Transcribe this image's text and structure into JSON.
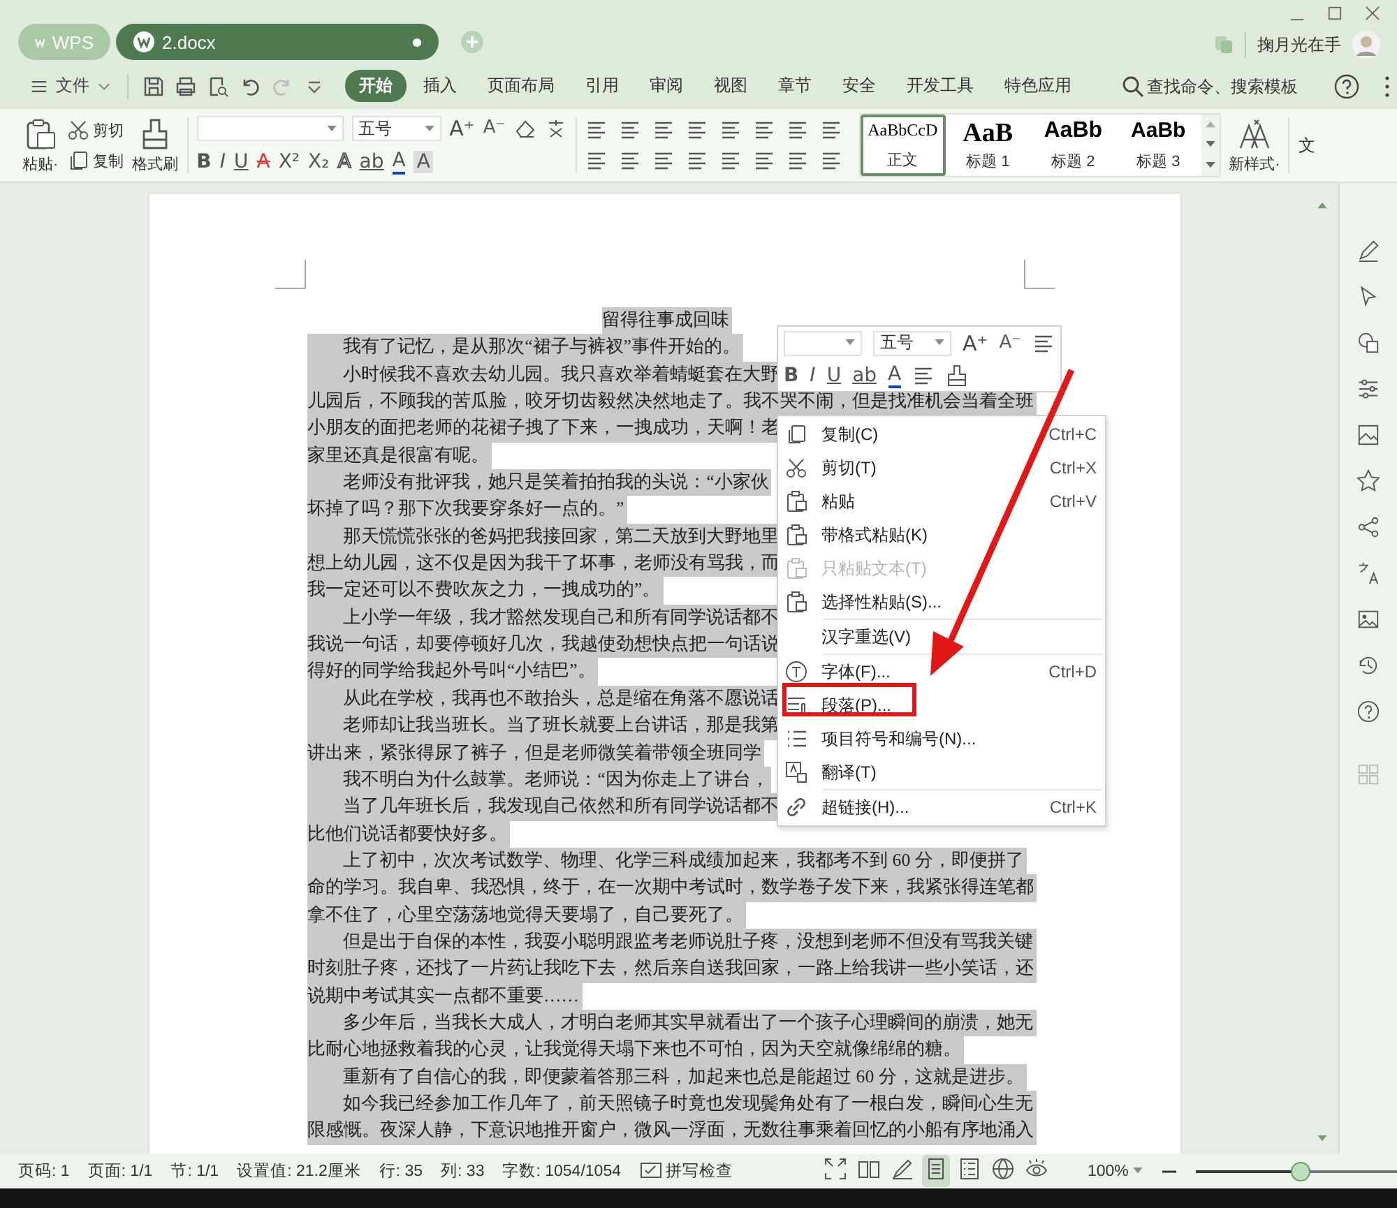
{
  "title_bar": {
    "tabs": [
      {
        "label": "WPS",
        "kind": "home",
        "selected": false
      },
      {
        "label": "2.docx",
        "kind": "document",
        "selected": true
      }
    ],
    "user_name": "掬月光在手"
  },
  "menu_bar": {
    "file_menu": "文件",
    "tabs": [
      {
        "label": "开始",
        "selected": true
      },
      {
        "label": "插入",
        "selected": false
      },
      {
        "label": "页面布局",
        "selected": false
      },
      {
        "label": "引用",
        "selected": false
      },
      {
        "label": "审阅",
        "selected": false
      },
      {
        "label": "视图",
        "selected": false
      },
      {
        "label": "章节",
        "selected": false
      },
      {
        "label": "安全",
        "selected": false
      },
      {
        "label": "开发工具",
        "selected": false
      },
      {
        "label": "特色应用",
        "selected": false
      }
    ],
    "search": {
      "placeholder": "查找命令、搜索模板"
    }
  },
  "ribbon": {
    "paste": "粘贴·",
    "cut": "剪切",
    "copy": "复制",
    "format_painter": "格式刷",
    "font_size": "五号",
    "font_row1": [
      {
        "glyph": "A⁺",
        "kind": "grow"
      },
      {
        "glyph": "A⁻",
        "kind": "shrink"
      }
    ],
    "font_row2": [
      {
        "glyph": "B",
        "kind": "bold"
      },
      {
        "glyph": "I",
        "kind": "italic"
      },
      {
        "glyph": "U",
        "kind": "underline"
      },
      {
        "glyph": "A",
        "kind": "strike"
      },
      {
        "glyph": "X²",
        "kind": "sup"
      },
      {
        "glyph": "X₂",
        "kind": "sub"
      },
      {
        "glyph": "A",
        "kind": "effect"
      },
      {
        "glyph": "ab",
        "kind": "highlight"
      },
      {
        "glyph": "A",
        "kind": "color"
      },
      {
        "glyph": "A",
        "kind": "shade"
      }
    ],
    "styles": [
      {
        "preview": "AaBbCcD",
        "label": "正文",
        "selected": true
      },
      {
        "preview": "AaB",
        "label": "标题 1",
        "selected": false
      },
      {
        "preview": "AaBb",
        "label": "标题 2",
        "selected": false
      },
      {
        "preview": "AaBb",
        "label": "标题 3",
        "selected": false
      }
    ],
    "new_style": "新样式·",
    "cut_label": "文"
  },
  "document": {
    "title": "留得往事成回味",
    "lines": [
      {
        "text": "我有了记忆，是从那次“裙子与裤衩”事件开始的。",
        "indent": true
      },
      {
        "text": "小时候我不喜欢去幼儿园。我只喜欢举着蜻蜓套在大野",
        "indent": true
      },
      {
        "text": "儿园后，不顾我的苦瓜脸，咬牙切齿毅然决然地走了。我不哭不闹，但是找准机会当着全班",
        "indent": false
      },
      {
        "text": "小朋友的面把老师的花裙子拽了下来，一拽成功，天啊！老",
        "indent": false
      },
      {
        "text": "家里还真是很富有呢。",
        "indent": false
      },
      {
        "text": "老师没有批评我，她只是笑着拍拍我的头说：“小家伙",
        "indent": true
      },
      {
        "text": "坏掉了吗？那下次我要穿条好一点的。”",
        "indent": false
      },
      {
        "text": "那天慌慌张张的爸妈把我接回家，第二天放到大野地里",
        "indent": true
      },
      {
        "text": "想上幼儿园，这不仅是因为我干了坏事，老师没有骂我，而",
        "indent": false
      },
      {
        "text": "我一定还可以不费吹灰之力，一拽成功的”。",
        "indent": false
      },
      {
        "text": "上小学一年级，我才豁然发现自己和所有同学说话都不",
        "indent": true
      },
      {
        "text": "我说一句话，却要停顿好几次，我越使劲想快点把一句话说",
        "indent": false
      },
      {
        "text": "得好的同学给我起外号叫“小结巴”。",
        "indent": false
      },
      {
        "text": "从此在学校，我再也不敢抬头，总是缩在角落不愿说话",
        "indent": true
      },
      {
        "text": "老师却让我当班长。当了班长就要上台讲话，那是我第",
        "indent": true
      },
      {
        "text": "讲出来，紧张得尿了裤子，但是老师微笑着带领全班同学",
        "indent": false
      },
      {
        "text": "我不明白为什么鼓掌。老师说：“因为你走上了讲台，",
        "indent": true
      },
      {
        "text": "当了几年班长后，我发现自己依然和所有同学说话都不",
        "indent": true
      },
      {
        "text": "比他们说话都要快好多。",
        "indent": false
      },
      {
        "text": "上了初中，次次考试数学、物理、化学三科成绩加起来，我都考不到 60 分，即便拼了",
        "indent": true
      },
      {
        "text": "命的学习。我自卑、我恐惧，终于，在一次期中考试时，数学卷子发下来，我紧张得连笔都",
        "indent": false
      },
      {
        "text": "拿不住了，心里空荡荡地觉得天要塌了，自己要死了。",
        "indent": false
      },
      {
        "text": "但是出于自保的本性，我耍小聪明跟监考老师说肚子疼，没想到老师不但没有骂我关键",
        "indent": true
      },
      {
        "text": "时刻肚子疼，还找了一片药让我吃下去，然后亲自送我回家，一路上给我讲一些小笑话，还",
        "indent": false
      },
      {
        "text": "说期中考试其实一点都不重要……",
        "indent": false
      },
      {
        "text": "多少年后，当我长大成人，才明白老师其实早就看出了一个孩子心理瞬间的崩溃，她无",
        "indent": true
      },
      {
        "text": "比耐心地拯救着我的心灵，让我觉得天塌下来也不可怕，因为天空就像绵绵的糖。",
        "indent": false
      },
      {
        "text": "重新有了自信心的我，即便蒙着答那三科，加起来也总是能超过 60 分，这就是进步。",
        "indent": true
      },
      {
        "text": "如今我已经参加工作几年了，前天照镜子时竟也发现鬓角处有了一根白发，瞬间心生无",
        "indent": true
      },
      {
        "text": "限感慨。夜深人静，下意识地推开窗户，微风一浮面，无数往事乘着回忆的小船有序地涌入",
        "indent": false
      }
    ]
  },
  "mini_toolbar": {
    "font_size": "五号",
    "row1": [
      {
        "glyph": "A⁺",
        "kind": "grow"
      },
      {
        "glyph": "A⁻",
        "kind": "shrink"
      }
    ],
    "row2": [
      {
        "glyph": "B",
        "kind": "bold"
      },
      {
        "glyph": "I",
        "kind": "italic"
      },
      {
        "glyph": "U",
        "kind": "underline"
      },
      {
        "glyph": "ab",
        "kind": "highlight"
      },
      {
        "glyph": "A",
        "kind": "color"
      }
    ]
  },
  "context_menu": {
    "groups": [
      [
        {
          "label": "复制(C)",
          "shortcut": "Ctrl+C",
          "disabled": false,
          "highlighted": false
        },
        {
          "label": "剪切(T)",
          "shortcut": "Ctrl+X",
          "disabled": false,
          "highlighted": false
        },
        {
          "label": "粘贴",
          "shortcut": "Ctrl+V",
          "disabled": false,
          "highlighted": false
        },
        {
          "label": "带格式粘贴(K)",
          "disabled": false,
          "highlighted": false
        },
        {
          "label": "只粘贴文本(T)",
          "disabled": true,
          "highlighted": false
        },
        {
          "label": "选择性粘贴(S)...",
          "disabled": false,
          "highlighted": false
        }
      ],
      [
        {
          "label": "汉字重选(V)",
          "disabled": false,
          "highlighted": false
        }
      ],
      [
        {
          "label": "字体(F)...",
          "shortcut": "Ctrl+D",
          "disabled": false,
          "highlighted": false
        },
        {
          "label": "段落(P)...",
          "disabled": false,
          "highlighted": true
        },
        {
          "label": "项目符号和编号(N)...",
          "disabled": false,
          "highlighted": false
        },
        {
          "label": "翻译(T)",
          "disabled": false,
          "highlighted": false
        }
      ],
      [
        {
          "label": "超链接(H)...",
          "shortcut": "Ctrl+K",
          "disabled": false,
          "highlighted": false
        }
      ]
    ]
  },
  "status_bar": {
    "fields": [
      "页码: 1",
      "页面: 1/1",
      "节: 1/1",
      "设置值: 21.2厘米",
      "行: 35",
      "列: 33",
      "字数: 1054/1054"
    ],
    "spell_check": "拼写检查",
    "views": [
      {
        "selected": false
      },
      {
        "selected": false
      },
      {
        "selected": false
      },
      {
        "selected": true
      },
      {
        "selected": false
      },
      {
        "selected": false
      },
      {
        "selected": false
      }
    ],
    "zoom": {
      "reading": "100%",
      "level": 0.5
    }
  }
}
